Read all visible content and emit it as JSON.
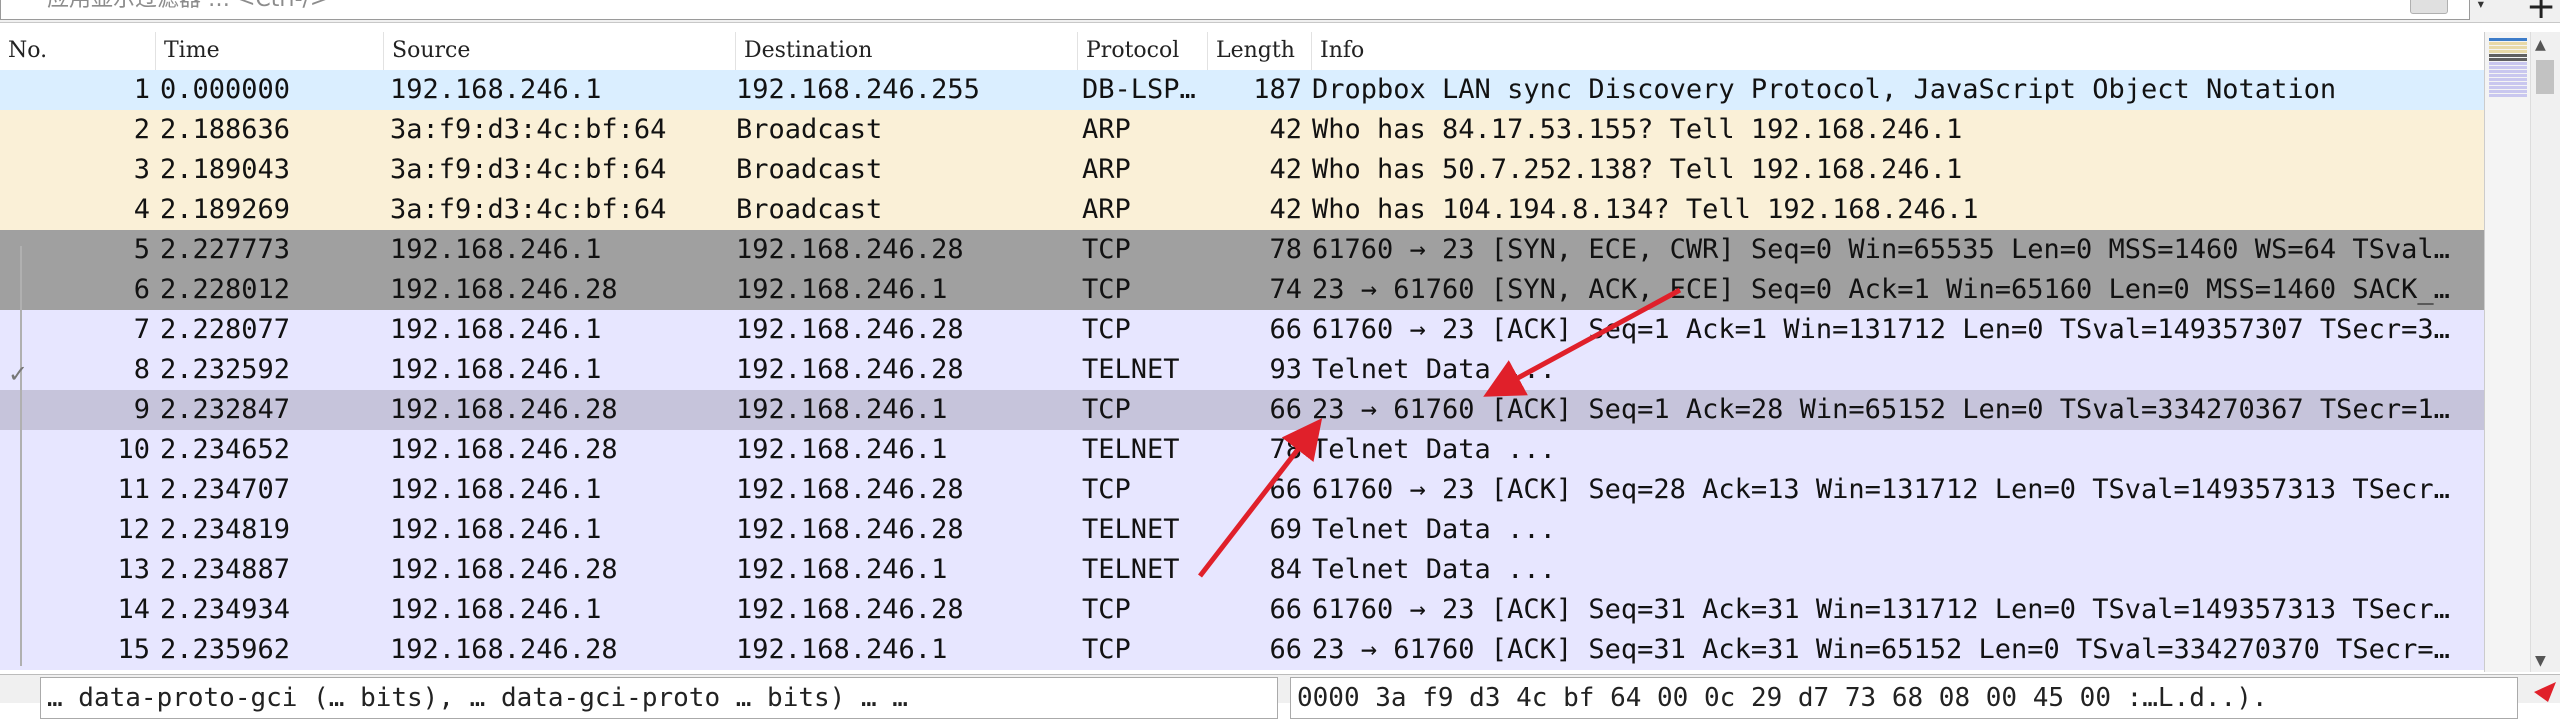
{
  "filter": {
    "placeholder": "应用显示过滤器 … <Ctrl-/>"
  },
  "columns": [
    {
      "key": "no",
      "label": "No."
    },
    {
      "key": "time",
      "label": "Time"
    },
    {
      "key": "source",
      "label": "Source"
    },
    {
      "key": "destination",
      "label": "Destination"
    },
    {
      "key": "protocol",
      "label": "Protocol"
    },
    {
      "key": "length",
      "label": "Length"
    },
    {
      "key": "info",
      "label": "Info"
    }
  ],
  "colors": {
    "udp_bg": "#daeeff",
    "arp_bg": "#faf0d7",
    "tcp_bg": "#e7e6ff",
    "selected_bg": "#a0a0a0",
    "related_bg": "#c6c4db",
    "arrow": "#e0202a"
  },
  "packets": [
    {
      "no": "1",
      "time": "0.000000",
      "source": "192.168.246.1",
      "destination": "192.168.246.255",
      "protocol": "DB-LSP…",
      "length": "187",
      "info": "Dropbox LAN sync Discovery Protocol, JavaScript Object Notation",
      "style": "udp"
    },
    {
      "no": "2",
      "time": "2.188636",
      "source": "3a:f9:d3:4c:bf:64",
      "destination": "Broadcast",
      "protocol": "ARP",
      "length": "42",
      "info": "Who has 84.17.53.155? Tell 192.168.246.1",
      "style": "arp"
    },
    {
      "no": "3",
      "time": "2.189043",
      "source": "3a:f9:d3:4c:bf:64",
      "destination": "Broadcast",
      "protocol": "ARP",
      "length": "42",
      "info": "Who has 50.7.252.138? Tell 192.168.246.1",
      "style": "arp"
    },
    {
      "no": "4",
      "time": "2.189269",
      "source": "3a:f9:d3:4c:bf:64",
      "destination": "Broadcast",
      "protocol": "ARP",
      "length": "42",
      "info": "Who has 104.194.8.134? Tell 192.168.246.1",
      "style": "arp"
    },
    {
      "no": "5",
      "time": "2.227773",
      "source": "192.168.246.1",
      "destination": "192.168.246.28",
      "protocol": "TCP",
      "length": "78",
      "info": "61760 → 23 [SYN, ECE, CWR] Seq=0 Win=65535 Len=0 MSS=1460 WS=64 TSval…",
      "style": "selected"
    },
    {
      "no": "6",
      "time": "2.228012",
      "source": "192.168.246.28",
      "destination": "192.168.246.1",
      "protocol": "TCP",
      "length": "74",
      "info": "23 → 61760 [SYN, ACK, ECE] Seq=0 Ack=1 Win=65160 Len=0 MSS=1460 SACK_…",
      "style": "selected"
    },
    {
      "no": "7",
      "time": "2.228077",
      "source": "192.168.246.1",
      "destination": "192.168.246.28",
      "protocol": "TCP",
      "length": "66",
      "info": "61760 → 23 [ACK] Seq=1 Ack=1 Win=131712 Len=0 TSval=149357307 TSecr=3…",
      "style": "tcp"
    },
    {
      "no": "8",
      "time": "2.232592",
      "source": "192.168.246.1",
      "destination": "192.168.246.28",
      "protocol": "TELNET",
      "length": "93",
      "info": "Telnet Data ...",
      "style": "tcp"
    },
    {
      "no": "9",
      "time": "2.232847",
      "source": "192.168.246.28",
      "destination": "192.168.246.1",
      "protocol": "TCP",
      "length": "66",
      "info": "23 → 61760 [ACK] Seq=1 Ack=28 Win=65152 Len=0 TSval=334270367 TSecr=1…",
      "style": "related"
    },
    {
      "no": "10",
      "time": "2.234652",
      "source": "192.168.246.28",
      "destination": "192.168.246.1",
      "protocol": "TELNET",
      "length": "78",
      "info": "Telnet Data ...",
      "style": "tcp"
    },
    {
      "no": "11",
      "time": "2.234707",
      "source": "192.168.246.1",
      "destination": "192.168.246.28",
      "protocol": "TCP",
      "length": "66",
      "info": "61760 → 23 [ACK] Seq=28 Ack=13 Win=131712 Len=0 TSval=149357313 TSecr…",
      "style": "tcp"
    },
    {
      "no": "12",
      "time": "2.234819",
      "source": "192.168.246.1",
      "destination": "192.168.246.28",
      "protocol": "TELNET",
      "length": "69",
      "info": "Telnet Data ...",
      "style": "tcp"
    },
    {
      "no": "13",
      "time": "2.234887",
      "source": "192.168.246.28",
      "destination": "192.168.246.1",
      "protocol": "TELNET",
      "length": "84",
      "info": "Telnet Data ...",
      "style": "tcp"
    },
    {
      "no": "14",
      "time": "2.234934",
      "source": "192.168.246.1",
      "destination": "192.168.246.28",
      "protocol": "TCP",
      "length": "66",
      "info": "61760 → 23 [ACK] Seq=31 Ack=31 Win=131712 Len=0 TSval=149357313 TSecr…",
      "style": "tcp"
    },
    {
      "no": "15",
      "time": "2.235962",
      "source": "192.168.246.28",
      "destination": "192.168.246.1",
      "protocol": "TCP",
      "length": "66",
      "info": "23 → 61760 [ACK] Seq=31 Ack=31 Win=65152 Len=0 TSval=334270370 TSecr=…",
      "style": "tcp"
    }
  ],
  "details_pane": {
    "left_text": "… data-proto-gci (… bits), … data-gci-proto … bits) … …",
    "right_text": "0000  3a f9 d3 4c bf 64 00 0c 29 d7 73 68 08 00 45 00  :…L.d..)."
  }
}
